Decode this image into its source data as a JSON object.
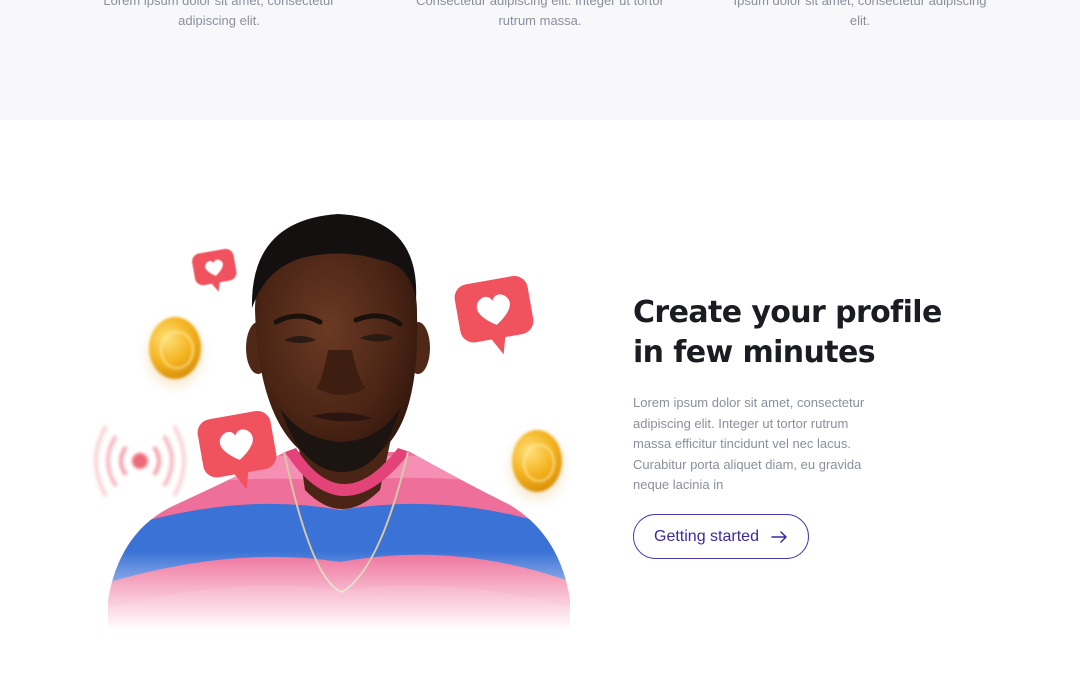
{
  "features": [
    {
      "lines": [
        "Lorem ipsum dolor sit amet, consectetur",
        "adipiscing elit."
      ]
    },
    {
      "lines": [
        "Consectetur adipiscing elit. Integer ut tortor",
        "rutrum massa."
      ]
    },
    {
      "lines": [
        "Ipsum dolor sit amet, consectetur adipiscing elit.",
        ""
      ]
    }
  ],
  "hero": {
    "headline_line1": "Create your profile",
    "headline_line2": "in few minutes",
    "body_lines": [
      "Lorem ipsum dolor sit amet, consectetur",
      "adipiscing elit. Integer ut tortor rutrum",
      "massa efficitur tincidunt vel nec lacus.",
      "Curabitur porta aliquet diam, eu gravida",
      "neque lacinia in"
    ],
    "cta_label": "Getting started",
    "cta_icon": "arrow-right-icon"
  },
  "illustration": {
    "icons": [
      "heart-bubble-icon",
      "coin-icon",
      "signal-icon"
    ]
  },
  "colors": {
    "accent": "#3b2aa0",
    "heart_bubble": "#f0525e",
    "coin": "#f4b31f",
    "headline": "#1a1c22",
    "body_text": "#8a8f9c",
    "band_bg": "#f8f8fb"
  }
}
